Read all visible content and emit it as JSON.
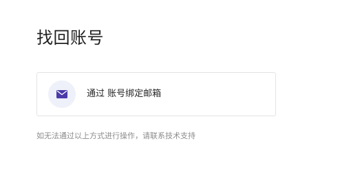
{
  "page": {
    "title": "找回账号"
  },
  "options": [
    {
      "label": "通过 账号绑定邮箱",
      "icon": "mail-icon",
      "icon_color": "#4b3aa9",
      "icon_bg": "#eef0fa"
    }
  ],
  "help": {
    "text": "如无法通过以上方式进行操作，请联系技术支持"
  }
}
